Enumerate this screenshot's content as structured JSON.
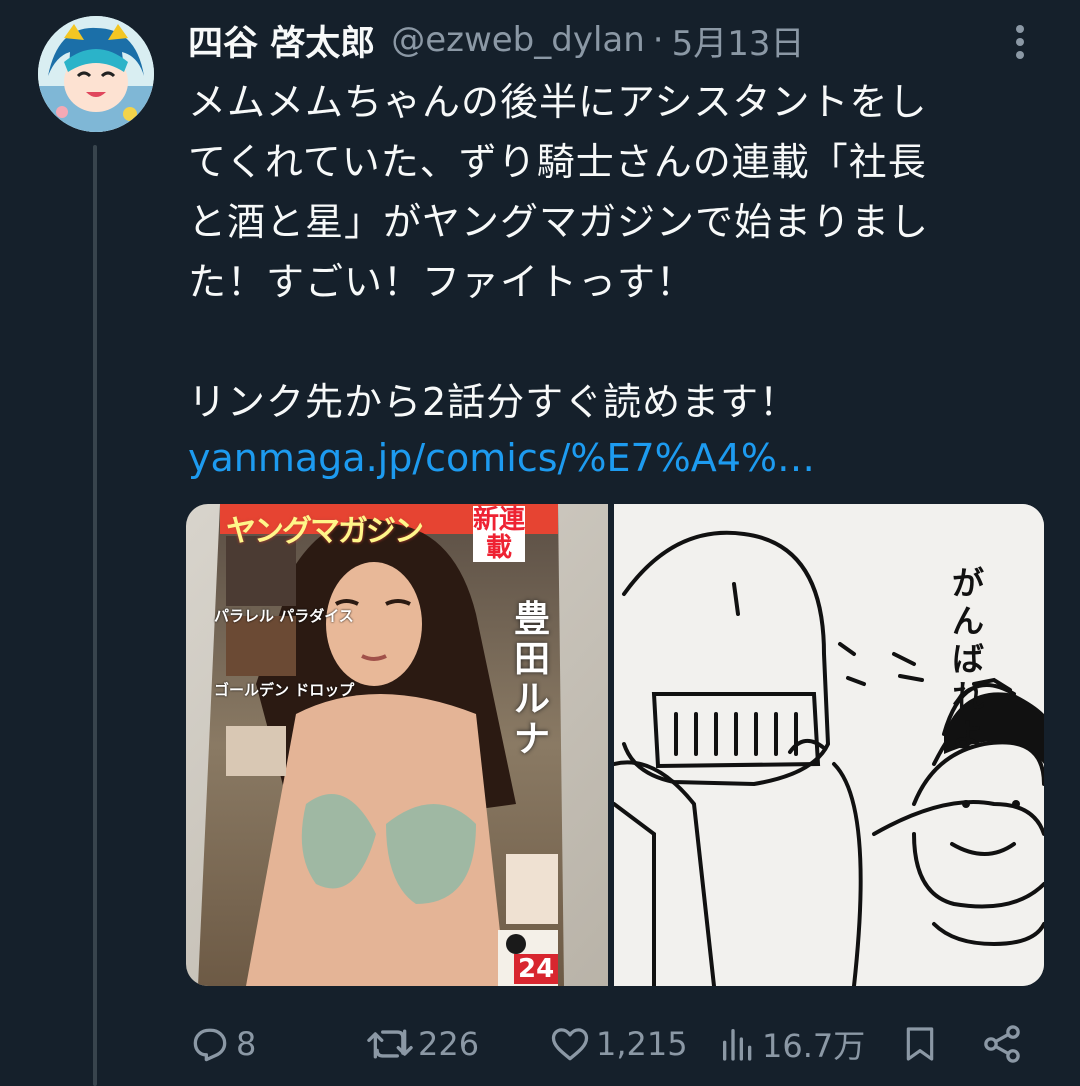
{
  "tweet": {
    "display_name": "四谷 啓太郎",
    "handle": "@ezweb_dylan",
    "separator": "·",
    "timestamp": "5月13日",
    "text_lines": [
      "メムメムちゃんの後半にアシスタントをし",
      "てくれていた、ずり騎士さんの連載「社長",
      "と酒と星」がヤングマガジンで始まりまし",
      "た！すごい！ファイトっす！",
      "",
      "リンク先から2話分すぐ読めます！"
    ],
    "link": "yanmaga.jp/comics/%E7%A4%…"
  },
  "media": {
    "left_image": {
      "description_icon": "magazine-cover-image",
      "cover_title": "ヤングマガジン",
      "badge": "新連載",
      "cover_name": "豊田ルナ",
      "side_labels": [
        "パラレル パラダイス",
        "ゴールデン ドロップ"
      ],
      "issue": "24"
    },
    "right_image": {
      "description_icon": "knight-manga-sketch-image",
      "speech_col1": "がんばれよ"
    }
  },
  "actions": {
    "reply": {
      "icon": "reply-icon",
      "count": "8"
    },
    "retweet": {
      "icon": "retweet-icon",
      "count": "226"
    },
    "like": {
      "icon": "heart-icon",
      "count": "1,215"
    },
    "views": {
      "icon": "views-chart-icon",
      "count": "16.7万"
    },
    "bookmark": {
      "icon": "bookmark-icon"
    },
    "share": {
      "icon": "share-icon"
    }
  },
  "colors": {
    "background": "#15202b",
    "text": "#f7f9f9",
    "muted": "#8b98a5",
    "link": "#1d9bf0",
    "thread_line": "#38444d"
  }
}
